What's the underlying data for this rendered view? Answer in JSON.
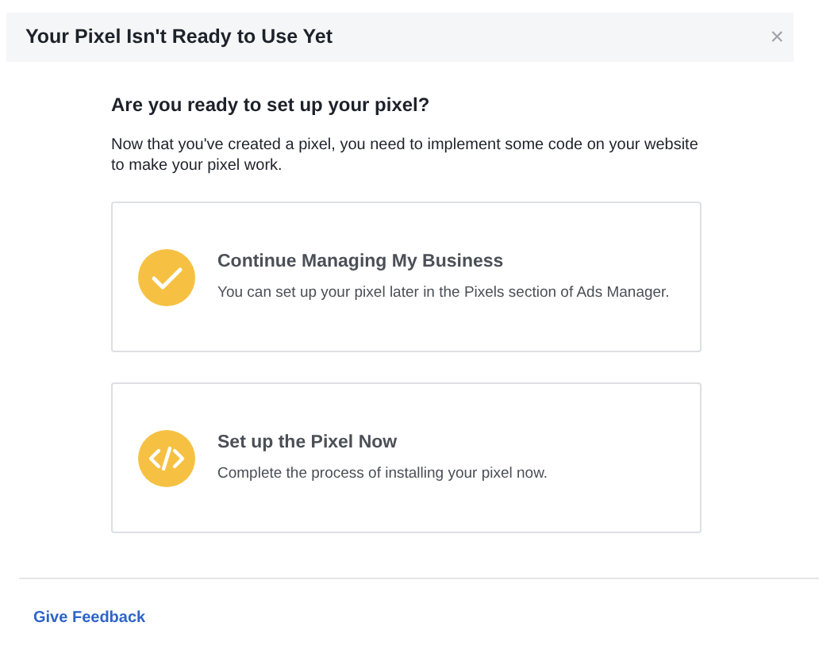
{
  "dialog": {
    "title": "Your Pixel Isn't Ready to Use Yet",
    "close": "×"
  },
  "heading": "Are you ready to set up your pixel?",
  "description": "Now that you've created a pixel, you need to implement some code on your website to make your pixel work.",
  "options": [
    {
      "kind": "check",
      "title": "Continue Managing My Business",
      "text": "You can set up your pixel later in the Pixels section of Ads Manager."
    },
    {
      "kind": "code",
      "title": "Set up the Pixel Now",
      "text": "Complete the process of installing your pixel now."
    }
  ],
  "footer_link": "Give Feedback"
}
